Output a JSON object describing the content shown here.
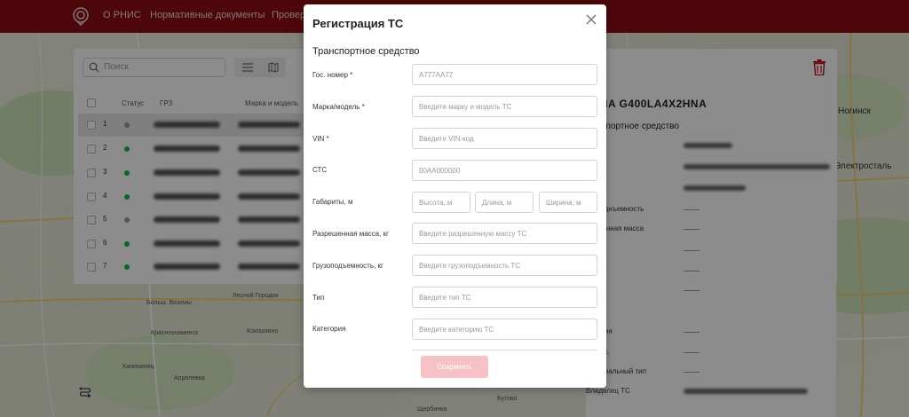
{
  "header": {
    "nav": [
      "О РНИС",
      "Нормативные документы",
      "Провер"
    ]
  },
  "list": {
    "search_placeholder": "Поиск",
    "columns": [
      "Статус",
      "ГРЗ",
      "Марка и модель"
    ],
    "rows": [
      {
        "num": "1",
        "status_color": "#999999"
      },
      {
        "num": "2",
        "status_color": "#22b14c"
      },
      {
        "num": "3",
        "status_color": "#22b14c"
      },
      {
        "num": "4",
        "status_color": "#22b14c"
      },
      {
        "num": "5",
        "status_color": "#999999"
      },
      {
        "num": "6",
        "status_color": "#22b14c"
      },
      {
        "num": "7",
        "status_color": "#22b14c"
      }
    ]
  },
  "details": {
    "title": "NIA G400LA4X2HNA",
    "subtitle": "нспортное средство",
    "labels": [
      "поднъемность",
      "шенная масса",
      "а",
      "на",
      "ория",
      "асс.",
      "иональный тип",
      "Владелец ТС"
    ]
  },
  "map": {
    "labels": [
      "Ногинск",
      "Электросталь",
      "Лесной Городок",
      "Больш. Вяземы",
      "Краснознаменск",
      "Кокошкино",
      "Калининец",
      "Апрелевка",
      "Щербинка",
      "Бутово"
    ]
  },
  "modal": {
    "title": "Регистрация ТС",
    "section": "Транспортное средство",
    "fields": {
      "plate": {
        "label": "Гос. номер *",
        "placeholder": "А777АА77"
      },
      "model": {
        "label": "Марка/модель *",
        "placeholder": "Введите марку и модель ТС"
      },
      "vin": {
        "label": "VIN *",
        "placeholder": "Введите VIN-код"
      },
      "sts": {
        "label": "СТС",
        "placeholder": "00АА000000"
      },
      "dims": {
        "label": "Габариты, м",
        "height_ph": "Высота, м",
        "length_ph": "Длина, м",
        "width_ph": "Ширина, м"
      },
      "mass": {
        "label": "Разрешенная масса, кг",
        "placeholder": "Введите разрешенную массу ТС"
      },
      "capacity": {
        "label": "Грузоподъемность, кг",
        "placeholder": "Введите грузоподъемность ТС"
      },
      "type": {
        "label": "Тип",
        "placeholder": "Введите тип ТС"
      },
      "category": {
        "label": "Категория",
        "placeholder": "Введите категорию ТС"
      }
    },
    "save_label": "Сохранить"
  },
  "colors": {
    "header": "#8c0e13",
    "accent": "#d0101a",
    "save_disabled": "#f6c2c6"
  }
}
